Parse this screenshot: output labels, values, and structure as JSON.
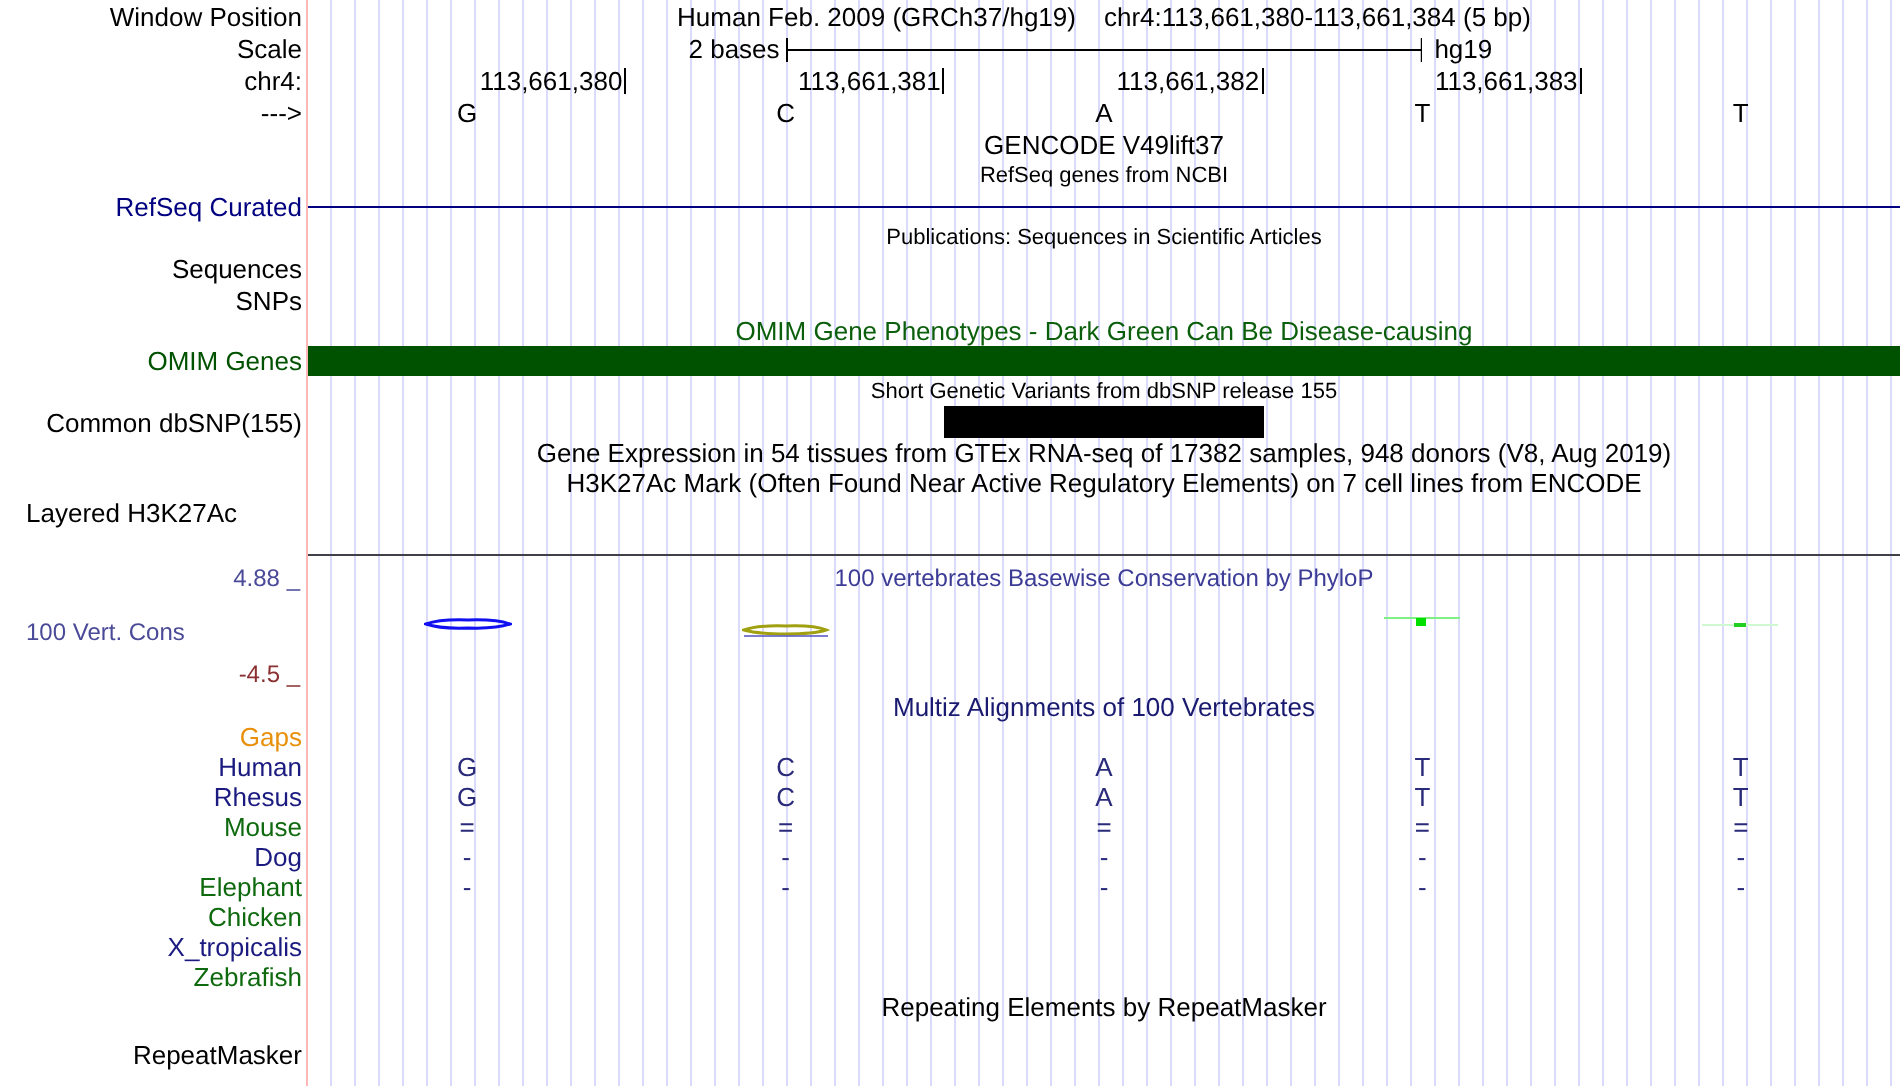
{
  "header": {
    "label": "Window Position",
    "assembly": "Human Feb. 2009 (GRCh37/hg19)",
    "position": "chr4:113,661,380-113,661,384 (5 bp)"
  },
  "scale": {
    "label": "Scale",
    "span": "2 bases",
    "assembly": "hg19"
  },
  "ruler": {
    "label": "chr4:",
    "positions": [
      "113,661,380",
      "113,661,381",
      "113,661,382",
      "113,661,383"
    ]
  },
  "strand": {
    "label": "--->",
    "bases": [
      "G",
      "C",
      "A",
      "T",
      "T"
    ]
  },
  "rows": [
    {
      "kind": "caption",
      "text": "GENCODE V49lift37"
    },
    {
      "kind": "note",
      "text": "RefSeq genes from NCBI"
    },
    {
      "kind": "line",
      "label": "RefSeq Curated",
      "color": "#000080"
    },
    {
      "kind": "note",
      "text": "Publications: Sequences in Scientific Articles"
    },
    {
      "kind": "label",
      "label": "Sequences"
    },
    {
      "kind": "label",
      "label": "SNPs"
    },
    {
      "kind": "caption",
      "text": "OMIM Gene Phenotypes - Dark Green Can Be Disease-causing",
      "color": "#0b5e0b"
    },
    {
      "kind": "bar",
      "label": "OMIM Genes",
      "color": "#005200"
    },
    {
      "kind": "note",
      "text": "Short Genetic Variants from dbSNP release 155"
    },
    {
      "kind": "variants",
      "label": "Common dbSNP(155)",
      "covered": [
        false,
        false,
        true,
        false,
        false
      ]
    },
    {
      "kind": "caption",
      "text": "Gene Expression in 54 tissues from GTEx RNA-seq of 17382 samples, 948 donors (V8, Aug 2019)"
    },
    {
      "kind": "caption",
      "text": "H3K27Ac Mark (Often Found Near Active Regulatory Elements) on 7 cell lines from ENCODE"
    },
    {
      "kind": "composite",
      "label": "Layered H3K27Ac"
    },
    {
      "kind": "rule"
    },
    {
      "kind": "conservation",
      "top": "4.88 _",
      "label": "100 Vert. Cons",
      "bottom": "-4.5 _",
      "title": "100 vertebrates Basewise Conservation by PhyloP"
    },
    {
      "kind": "caption",
      "text": "Multiz Alignments of 100 Vertebrates",
      "color": "#1a1a70"
    },
    {
      "kind": "species",
      "label": "Gaps",
      "color": "#e8900a"
    },
    {
      "kind": "species",
      "label": "Human",
      "color": "#1a1a80",
      "bases": [
        "G",
        "C",
        "A",
        "T",
        "T"
      ]
    },
    {
      "kind": "species",
      "label": "Rhesus",
      "color": "#1a1a80",
      "bases": [
        "G",
        "C",
        "A",
        "T",
        "T"
      ]
    },
    {
      "kind": "species",
      "label": "Mouse",
      "color": "#0f6a0f",
      "bases": [
        "=",
        "=",
        "=",
        "=",
        "="
      ]
    },
    {
      "kind": "species",
      "label": "Dog",
      "color": "#1a1a80",
      "bases": [
        "-",
        "-",
        "-",
        "-",
        "-"
      ]
    },
    {
      "kind": "species",
      "label": "Elephant",
      "color": "#0f6a0f",
      "bases": [
        "-",
        "-",
        "-",
        "-",
        "-"
      ]
    },
    {
      "kind": "species",
      "label": "Chicken",
      "color": "#0f6a0f"
    },
    {
      "kind": "species",
      "label": "X_tropicalis",
      "color": "#1a1a80"
    },
    {
      "kind": "species",
      "label": "Zebrafish",
      "color": "#0f6a0f"
    },
    {
      "kind": "caption",
      "text": "Repeating Elements by RepeatMasker"
    },
    {
      "kind": "label",
      "label": "RepeatMasker"
    }
  ]
}
